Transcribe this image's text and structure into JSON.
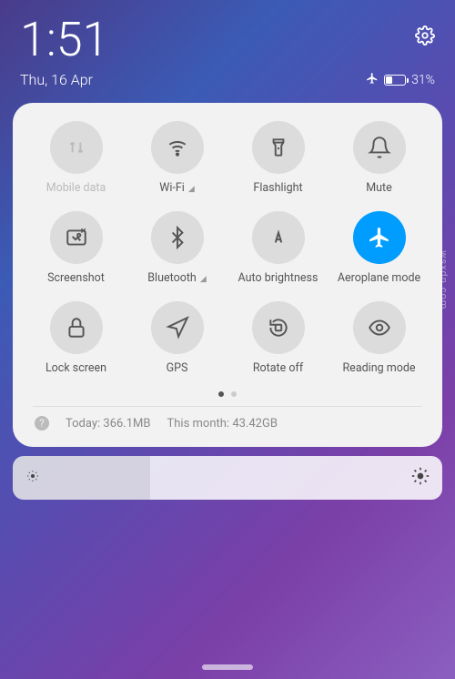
{
  "status": {
    "time": "1:51",
    "date": "Thu, 16 Apr",
    "battery_pct": "31%"
  },
  "toggles": [
    {
      "key": "mobile-data",
      "label": "Mobile data",
      "state": "disabled",
      "signal": false
    },
    {
      "key": "wifi",
      "label": "Wi-Fi",
      "state": "off",
      "signal": true
    },
    {
      "key": "flashlight",
      "label": "Flashlight",
      "state": "off",
      "signal": false
    },
    {
      "key": "mute",
      "label": "Mute",
      "state": "off",
      "signal": false
    },
    {
      "key": "screenshot",
      "label": "Screenshot",
      "state": "off",
      "signal": false
    },
    {
      "key": "bluetooth",
      "label": "Bluetooth",
      "state": "off",
      "signal": true
    },
    {
      "key": "auto-brightness",
      "label": "Auto brightness",
      "state": "off",
      "signal": false
    },
    {
      "key": "aeroplane-mode",
      "label": "Aeroplane mode",
      "state": "active",
      "signal": false
    },
    {
      "key": "lock-screen",
      "label": "Lock screen",
      "state": "off",
      "signal": false
    },
    {
      "key": "gps",
      "label": "GPS",
      "state": "off",
      "signal": false
    },
    {
      "key": "rotate-off",
      "label": "Rotate off",
      "state": "off",
      "signal": false
    },
    {
      "key": "reading-mode",
      "label": "Reading mode",
      "state": "off",
      "signal": false
    }
  ],
  "data_usage": {
    "today_label": "Today:",
    "today_value": "366.1MB",
    "month_label": "This month:",
    "month_value": "43.42GB"
  },
  "watermark": "wsxdn.com"
}
